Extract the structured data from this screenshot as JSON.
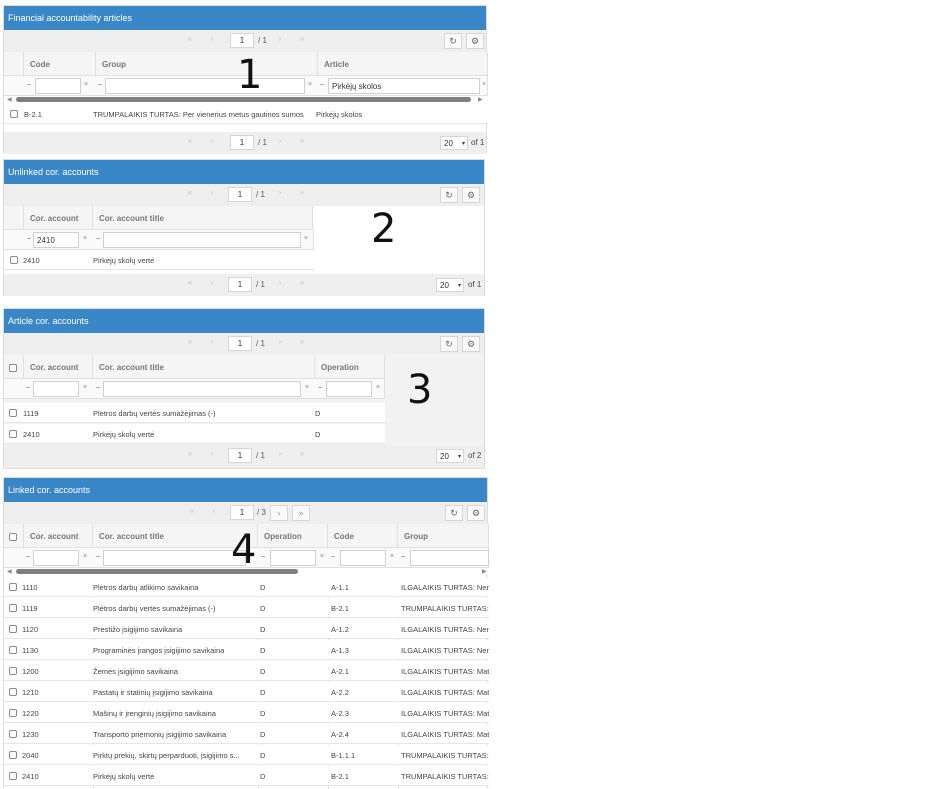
{
  "panel1": {
    "title": "Financial accountability articles",
    "page": "1",
    "page_total": "/ 1",
    "page_size": "20",
    "of_label": "of 1",
    "headers": [
      "Code",
      "Group",
      "Article"
    ],
    "filter_op": "~",
    "filter_clear": "×",
    "filter_article_value": "Pirkėjų skolos",
    "rows": [
      {
        "code": "B-2.1",
        "group": "TRUMPALAIKIS TURTAS: Per vienerius metus gautinos sumos",
        "article": "Pirkėjų skolos"
      }
    ],
    "annotation": "1"
  },
  "panel2": {
    "title": "Unlinked cor. accounts",
    "page": "1",
    "page_total": "/ 1",
    "page_size": "20",
    "of_label": "of 1",
    "headers": [
      "Cor. account",
      "Cor. account title"
    ],
    "filter_op": "~",
    "filter_clear": "×",
    "filter_account_value": "2410",
    "rows": [
      {
        "account": "2410",
        "title": "Pirkėjų skolų vertė"
      }
    ],
    "annotation": "2"
  },
  "panel3": {
    "title": "Article cor. accounts",
    "page": "1",
    "page_total": "/ 1",
    "page_size": "20",
    "of_label": "of 2",
    "headers": [
      "Cor. account",
      "Cor. account title",
      "Operation"
    ],
    "filter_op": "~",
    "filter_clear": "×",
    "rows": [
      {
        "account": "1119",
        "title": "Plėtros darbų vertės sumažėjimas (-)",
        "operation": "D"
      },
      {
        "account": "2410",
        "title": "Pirkėjų skolų vertė",
        "operation": "D"
      }
    ],
    "annotation": "3"
  },
  "panel4": {
    "title": "Linked cor. accounts",
    "page": "1",
    "page_total": "/ 3",
    "headers": [
      "Cor. account",
      "Cor. account title",
      "Operation",
      "Code",
      "Group"
    ],
    "filter_op": "~",
    "filter_clear": "×",
    "rows": [
      {
        "account": "1110",
        "title": "Plėtros darbų atlikimo savikaina",
        "operation": "D",
        "code": "A-1.1",
        "group": "ILGALAIKIS TURTAS: Nem"
      },
      {
        "account": "1119",
        "title": "Plėtros darbų vertės sumažėjimas (-)",
        "operation": "D",
        "code": "B-2.1",
        "group": "TRUMPALAIKIS TURTAS:"
      },
      {
        "account": "1120",
        "title": "Prestižo įsigijimo savikaina",
        "operation": "D",
        "code": "A-1.2",
        "group": "ILGALAIKIS TURTAS: Nem"
      },
      {
        "account": "1130",
        "title": "Programinės įrangos įsigijimo savikaina",
        "operation": "D",
        "code": "A-1.3",
        "group": "ILGALAIKIS TURTAS: Nem"
      },
      {
        "account": "1200",
        "title": "Žemės įsigijimo savikaina",
        "operation": "D",
        "code": "A-2.1",
        "group": "ILGALAIKIS TURTAS: Mat"
      },
      {
        "account": "1210",
        "title": "Pastatų ir statinių įsigijimo savikaina",
        "operation": "D",
        "code": "A-2.2",
        "group": "ILGALAIKIS TURTAS: Mat"
      },
      {
        "account": "1220",
        "title": "Mašinų ir įrenginių įsigijimo savikaina",
        "operation": "D",
        "code": "A-2.3",
        "group": "ILGALAIKIS TURTAS: Mat"
      },
      {
        "account": "1230",
        "title": "Transporto priemonių įsigijimo savikaina",
        "operation": "D",
        "code": "A-2.4",
        "group": "ILGALAIKIS TURTAS: Mat"
      },
      {
        "account": "2040",
        "title": "Pirktų prekių, skirtų perparduoti, įsigijimo s...",
        "operation": "D",
        "code": "B-1.1.1",
        "group": "TRUMPALAIKIS TURTAS:"
      },
      {
        "account": "2410",
        "title": "Pirkėjų skolų vertė",
        "operation": "D",
        "code": "B-2.1",
        "group": "TRUMPALAIKIS TURTAS:"
      }
    ],
    "annotation": "4"
  },
  "icons": {
    "refresh": "refresh-icon",
    "settings": "gear-icon",
    "first": "«",
    "prev": "‹",
    "next": "›",
    "last": "»",
    "caret": "▾"
  }
}
